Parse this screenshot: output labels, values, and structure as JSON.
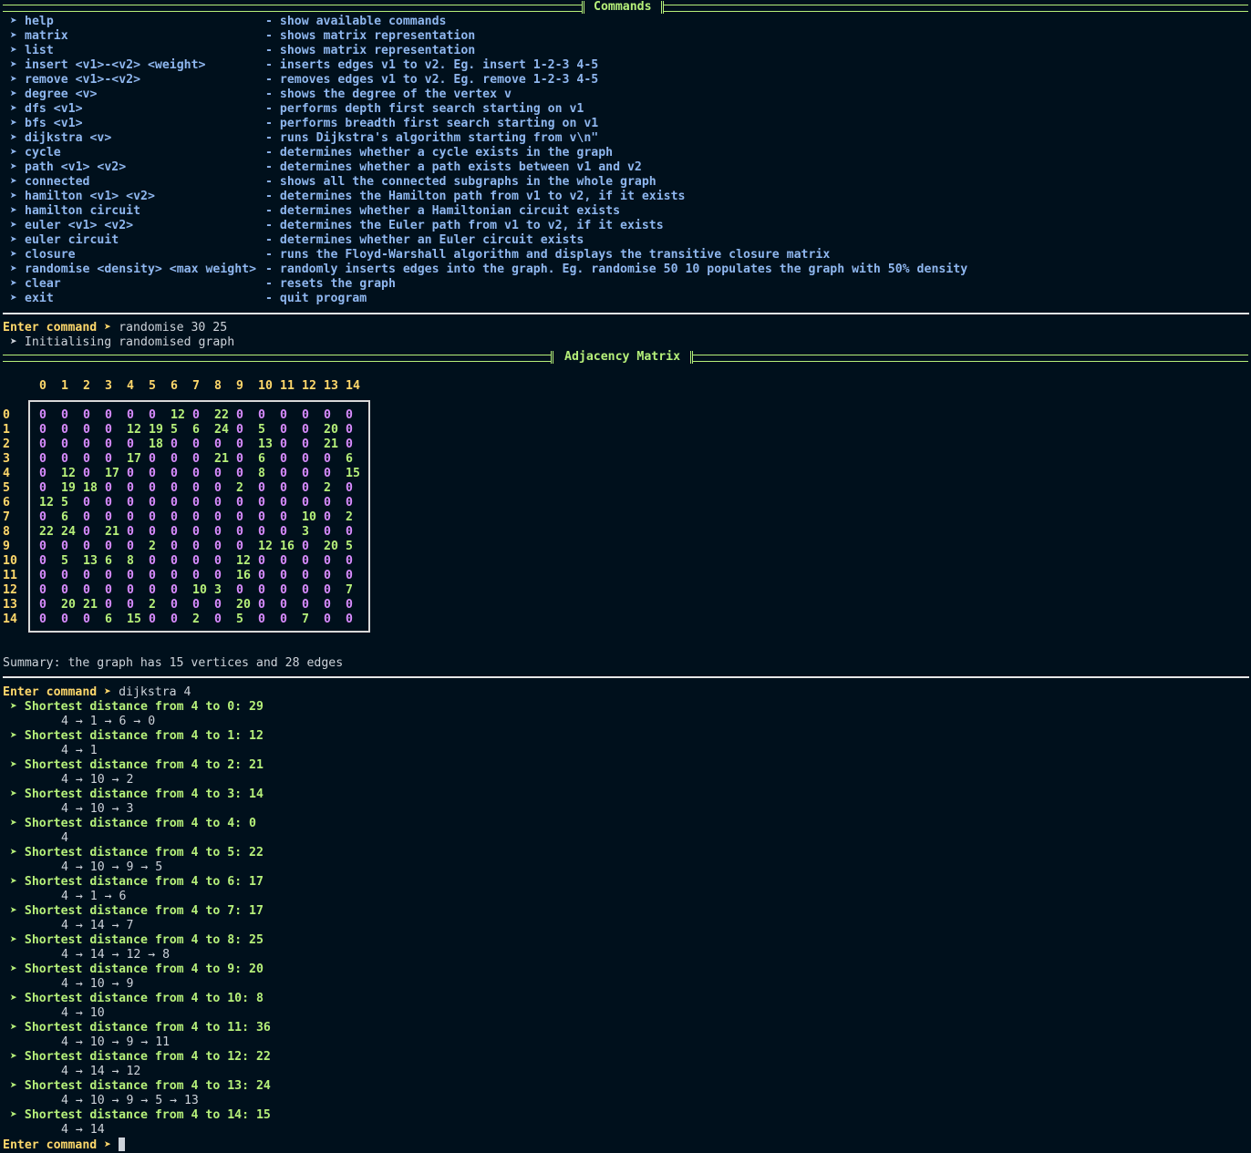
{
  "headers": {
    "commands": "Commands",
    "matrix": "Adjacency Matrix"
  },
  "prompt_arrow": "➤",
  "commands": [
    {
      "cmd": "help",
      "desc": "- show available commands"
    },
    {
      "cmd": "matrix",
      "desc": "- shows matrix representation"
    },
    {
      "cmd": "list",
      "desc": "- shows matrix representation"
    },
    {
      "cmd": "insert <v1>-<v2> <weight>",
      "desc": "- inserts edges v1 to v2. Eg. insert 1-2-3 4-5"
    },
    {
      "cmd": "remove <v1>-<v2>",
      "desc": "- removes edges v1 to v2. Eg. remove 1-2-3 4-5"
    },
    {
      "cmd": "degree <v>",
      "desc": "- shows the degree of the vertex v"
    },
    {
      "cmd": "dfs <v1>",
      "desc": "- performs depth first search starting on v1"
    },
    {
      "cmd": "bfs <v1>",
      "desc": "- performs breadth first search starting on v1"
    },
    {
      "cmd": "dijkstra <v>",
      "desc": "- runs Dijkstra's algorithm starting from v\\n\""
    },
    {
      "cmd": "cycle",
      "desc": "- determines whether a cycle exists in the graph"
    },
    {
      "cmd": "path <v1> <v2>",
      "desc": "- determines whether a path exists between v1 and v2"
    },
    {
      "cmd": "connected",
      "desc": "- shows all the connected subgraphs in the whole graph"
    },
    {
      "cmd": "hamilton <v1> <v2>",
      "desc": "- determines the Hamilton path from v1 to v2, if it exists"
    },
    {
      "cmd": "hamilton circuit",
      "desc": "- determines whether a Hamiltonian circuit exists"
    },
    {
      "cmd": "euler <v1> <v2>",
      "desc": "- determines the Euler path from v1 to v2, if it exists"
    },
    {
      "cmd": "euler circuit",
      "desc": "- determines whether an Euler circuit exists"
    },
    {
      "cmd": "closure",
      "desc": "- runs the Floyd-Warshall algorithm and displays the transitive closure matrix"
    },
    {
      "cmd": "randomise <density> <max weight>",
      "desc": "- randomly inserts edges into the graph. Eg. randomise 50 10 populates the graph with 50% density"
    },
    {
      "cmd": "clear",
      "desc": "- resets the graph"
    },
    {
      "cmd": "exit",
      "desc": "- quit program"
    }
  ],
  "session": {
    "prompt_label": "Enter command",
    "cmd1": "randomise 30 25",
    "cmd1_msg": "Initialising randomised graph",
    "summary": "Summary: the graph has 15 vertices and 28 edges",
    "cmd2": "dijkstra 4"
  },
  "matrix": {
    "labels": [
      "0",
      "1",
      "2",
      "3",
      "4",
      "5",
      "6",
      "7",
      "8",
      "9",
      "10",
      "11",
      "12",
      "13",
      "14"
    ],
    "rows": [
      [
        0,
        0,
        0,
        0,
        0,
        0,
        12,
        0,
        22,
        0,
        0,
        0,
        0,
        0,
        0
      ],
      [
        0,
        0,
        0,
        0,
        12,
        19,
        5,
        6,
        24,
        0,
        5,
        0,
        0,
        20,
        0
      ],
      [
        0,
        0,
        0,
        0,
        0,
        18,
        0,
        0,
        0,
        0,
        13,
        0,
        0,
        21,
        0
      ],
      [
        0,
        0,
        0,
        0,
        17,
        0,
        0,
        0,
        21,
        0,
        6,
        0,
        0,
        0,
        6
      ],
      [
        0,
        12,
        0,
        17,
        0,
        0,
        0,
        0,
        0,
        0,
        8,
        0,
        0,
        0,
        15
      ],
      [
        0,
        19,
        18,
        0,
        0,
        0,
        0,
        0,
        0,
        2,
        0,
        0,
        0,
        2,
        0
      ],
      [
        12,
        5,
        0,
        0,
        0,
        0,
        0,
        0,
        0,
        0,
        0,
        0,
        0,
        0,
        0
      ],
      [
        0,
        6,
        0,
        0,
        0,
        0,
        0,
        0,
        0,
        0,
        0,
        0,
        10,
        0,
        2
      ],
      [
        22,
        24,
        0,
        21,
        0,
        0,
        0,
        0,
        0,
        0,
        0,
        0,
        3,
        0,
        0
      ],
      [
        0,
        0,
        0,
        0,
        0,
        2,
        0,
        0,
        0,
        0,
        12,
        16,
        0,
        20,
        5
      ],
      [
        0,
        5,
        13,
        6,
        8,
        0,
        0,
        0,
        0,
        12,
        0,
        0,
        0,
        0,
        0
      ],
      [
        0,
        0,
        0,
        0,
        0,
        0,
        0,
        0,
        0,
        16,
        0,
        0,
        0,
        0,
        0
      ],
      [
        0,
        0,
        0,
        0,
        0,
        0,
        0,
        10,
        3,
        0,
        0,
        0,
        0,
        0,
        7
      ],
      [
        0,
        20,
        21,
        0,
        0,
        2,
        0,
        0,
        0,
        20,
        0,
        0,
        0,
        0,
        0
      ],
      [
        0,
        0,
        0,
        6,
        15,
        0,
        0,
        2,
        0,
        5,
        0,
        0,
        7,
        0,
        0
      ]
    ]
  },
  "dijkstra": [
    {
      "text": "Shortest distance from 4 to 0: 29",
      "path": "4 → 1 → 6 → 0"
    },
    {
      "text": "Shortest distance from 4 to 1: 12",
      "path": "4 → 1"
    },
    {
      "text": "Shortest distance from 4 to 2: 21",
      "path": "4 → 10 → 2"
    },
    {
      "text": "Shortest distance from 4 to 3: 14",
      "path": "4 → 10 → 3"
    },
    {
      "text": "Shortest distance from 4 to 4: 0",
      "path": "4"
    },
    {
      "text": "Shortest distance from 4 to 5: 22",
      "path": "4 → 10 → 9 → 5"
    },
    {
      "text": "Shortest distance from 4 to 6: 17",
      "path": "4 → 1 → 6"
    },
    {
      "text": "Shortest distance from 4 to 7: 17",
      "path": "4 → 14 → 7"
    },
    {
      "text": "Shortest distance from 4 to 8: 25",
      "path": "4 → 14 → 12 → 8"
    },
    {
      "text": "Shortest distance from 4 to 9: 20",
      "path": "4 → 10 → 9"
    },
    {
      "text": "Shortest distance from 4 to 10: 8",
      "path": "4 → 10"
    },
    {
      "text": "Shortest distance from 4 to 11: 36",
      "path": "4 → 10 → 9 → 11"
    },
    {
      "text": "Shortest distance from 4 to 12: 22",
      "path": "4 → 14 → 12"
    },
    {
      "text": "Shortest distance from 4 to 13: 24",
      "path": "4 → 10 → 9 → 5 → 13"
    },
    {
      "text": "Shortest distance from 4 to 14: 15",
      "path": "4 → 14"
    }
  ]
}
